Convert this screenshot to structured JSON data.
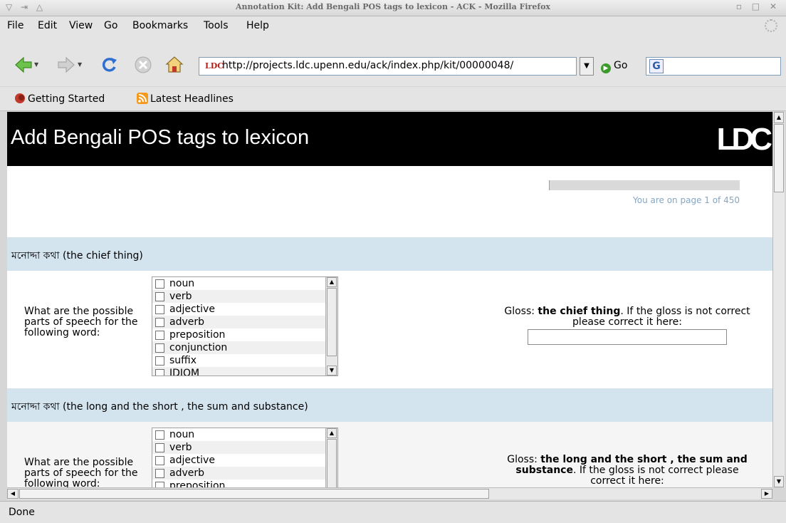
{
  "window": {
    "title": "Annotation Kit: Add Bengali POS tags to lexicon - ACK - Mozilla Firefox",
    "left_controls": "▽ ⇥ △",
    "right_controls": "▫ □ ✕"
  },
  "menu": {
    "file": "File",
    "edit": "Edit",
    "view": "View",
    "go": "Go",
    "bookmarks": "Bookmarks",
    "tools": "Tools",
    "help": "Help"
  },
  "navbar": {
    "favicon": "LDC",
    "url": "http://projects.ldc.upenn.edu/ack/index.php/kit/00000048/",
    "go_label": "Go",
    "search_engine": "G"
  },
  "bookmarks": {
    "getting_started": "Getting Started",
    "latest_headlines": "Latest Headlines"
  },
  "page": {
    "heading": "Add Bengali POS tags to lexicon",
    "logo": "LDC",
    "progress_fraction": 0.0022,
    "page_status": "You are on page 1 of 450",
    "entries": [
      {
        "word": "মনোদ্দা কথা (the chief thing)",
        "question": "What are the possible parts of speech for the following word:",
        "options": [
          "noun",
          "verb",
          "adjective",
          "adverb",
          "preposition",
          "conjunction",
          "suffix",
          "IDIOM"
        ],
        "gloss_prefix": "Gloss: ",
        "gloss": "the chief thing",
        "gloss_suffix": ". If the gloss is not correct please correct it here:",
        "gloss_input_value": ""
      },
      {
        "word": "মনোদ্দা কথা (the long and the short , the sum and substance)",
        "question": "What are the possible parts of speech for the following word:",
        "options": [
          "noun",
          "verb",
          "adjective",
          "adverb",
          "preposition"
        ],
        "gloss_prefix": "Gloss: ",
        "gloss": "the long and the short , the sum and substance",
        "gloss_suffix": ". If the gloss is not correct please correct it here:"
      }
    ]
  },
  "status": {
    "text": "Done"
  }
}
